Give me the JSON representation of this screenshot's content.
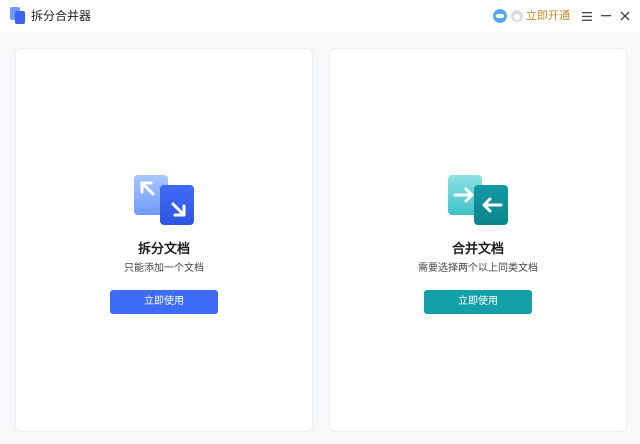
{
  "app": {
    "title": "拆分合并器"
  },
  "titlebar": {
    "vip_label": "立即开通",
    "icons": [
      "app-logo-icon",
      "vip-avatar-icon",
      "coin-icon",
      "menu-icon",
      "minimize-icon",
      "close-icon"
    ]
  },
  "cards": {
    "split": {
      "title": "拆分文档",
      "description": "只能添加一个文档",
      "button_label": "立即使用",
      "icon": "split-document-icon",
      "accent": "#3f6cf6"
    },
    "merge": {
      "title": "合并文档",
      "description": "需要选择两个以上同类文档",
      "button_label": "立即使用",
      "icon": "merge-document-icon",
      "accent": "#14a0a8"
    }
  },
  "colors": {
    "background": "#f7f8fa",
    "vip_text": "#c8892c"
  }
}
